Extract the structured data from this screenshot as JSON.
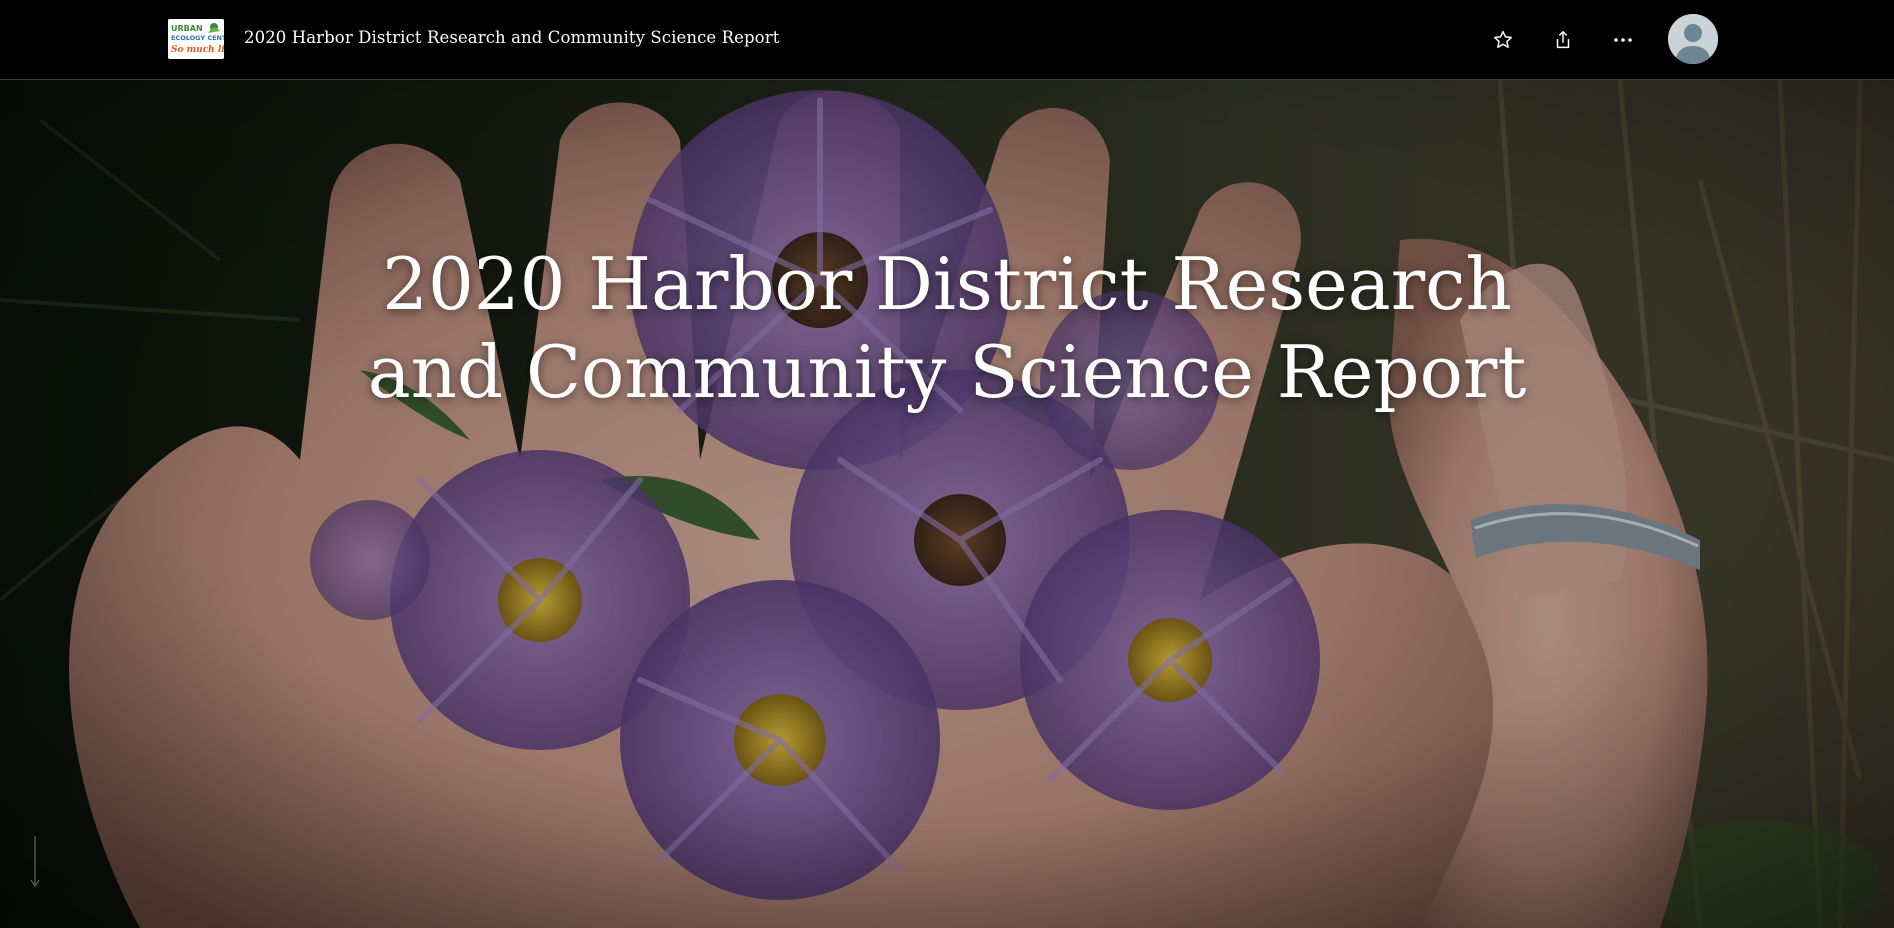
{
  "header": {
    "logo_text_top": "URBAN",
    "logo_text_mid": "ECOLOGY CENTER",
    "logo_text_tagline": "So much life.",
    "story_title": "2020 Harbor District Research and Community Science Report",
    "icons": [
      "star-icon",
      "share-icon",
      "more-icon",
      "avatar"
    ]
  },
  "hero": {
    "title": "2020 Harbor District Research and Community Science Report"
  },
  "colors": {
    "topbar_bg": "#000000",
    "title_text": "#ffffff",
    "logo_green": "#3a8a3a",
    "logo_blue": "#2f6eb5",
    "logo_orange": "#e35b1c",
    "aster_purple": "#7a5aa6",
    "aster_center": "#d8b52a"
  }
}
